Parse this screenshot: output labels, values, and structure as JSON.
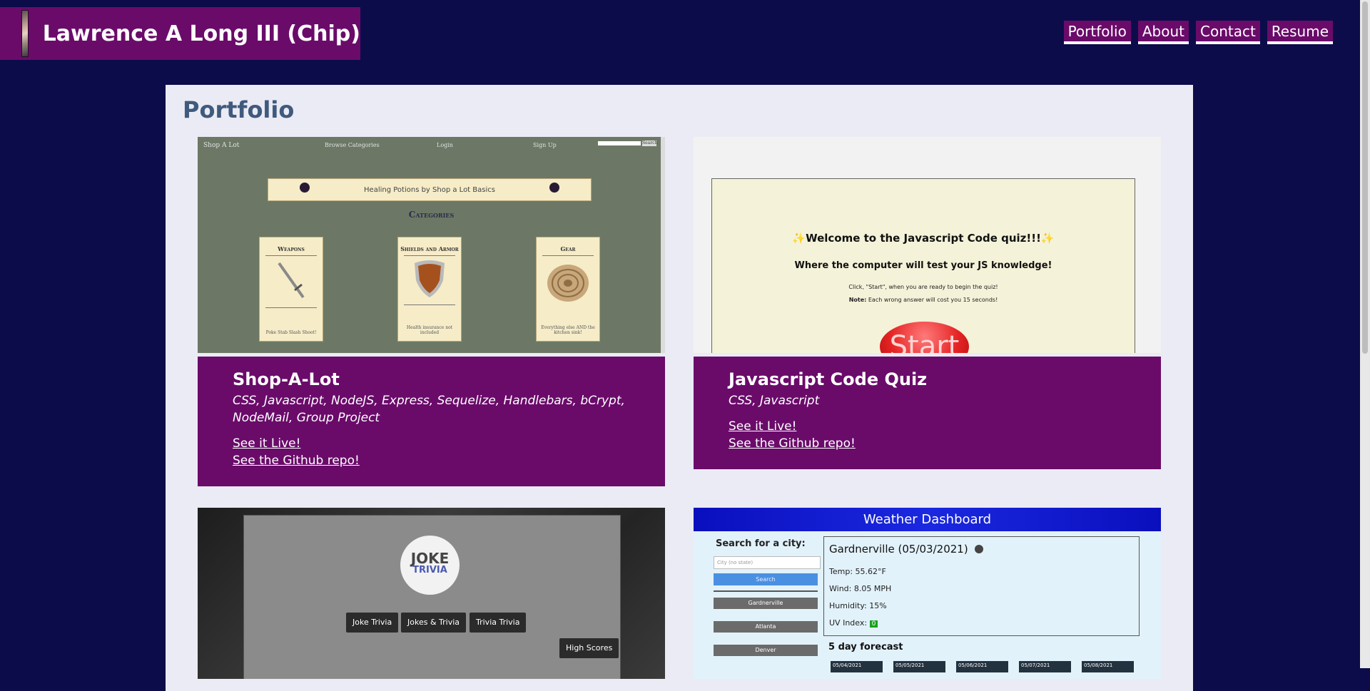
{
  "header": {
    "site_title": "Lawrence A Long III (Chip)"
  },
  "nav": [
    "Portfolio",
    "About",
    "Contact",
    "Resume"
  ],
  "main": {
    "heading": "Portfolio"
  },
  "projects": [
    {
      "title": "Shop-A-Lot",
      "tech": "CSS, Javascript, NodeJS, Express, Sequelize, Handlebars, bCrypt, NodeMail, Group Project",
      "live_link": "See it Live!",
      "repo_link": "See the Github repo!",
      "screenshot": {
        "brand": "Shop A Lot",
        "nav": [
          "Browse Categories",
          "Login",
          "Sign Up"
        ],
        "search_button": "Search",
        "banner": "Healing Potions by Shop a Lot Basics",
        "categories_heading": "Categories",
        "categories": [
          {
            "name": "Weapons",
            "desc": "Poke Stab Slash Shoot!"
          },
          {
            "name": "Shields and Armor",
            "desc": "Health insurance not included"
          },
          {
            "name": "Gear",
            "desc": "Everything else AND the kitchen sink!"
          }
        ]
      }
    },
    {
      "title": "Javascript Code Quiz",
      "tech": "CSS, Javascript",
      "live_link": "See it Live!",
      "repo_link": "See the Github repo!",
      "screenshot": {
        "welcome": "✨Welcome to the Javascript Code quiz!!!✨",
        "subtitle": "Where the computer will test your JS knowledge!",
        "instruction": "Click, \"Start\", when you are ready to begin the quiz!",
        "note_label": "Note:",
        "note_text": " Each wrong answer will cost you 15 seconds!",
        "start": "Start"
      }
    },
    {
      "title": "Joke Trivia",
      "screenshot": {
        "logo_top": "JOKE",
        "logo_bottom": "TRIVIA",
        "buttons": [
          "Joke Trivia",
          "Jokes & Trivia",
          "Trivia Trivia"
        ],
        "high_scores": "High Scores"
      }
    },
    {
      "title": "Weather Dashboard",
      "screenshot": {
        "bar_title": "Weather Dashboard",
        "search_label": "Search for a city:",
        "input_placeholder": "City (no state)",
        "search_button": "Search",
        "cities": [
          "Gardnerville",
          "Atlanta",
          "Denver"
        ],
        "current_title": "Gardnerville (05/03/2021)",
        "temp": "Temp: 55.62°F",
        "wind": "Wind: 8.05 MPH",
        "humidity": "Humidity: 15%",
        "uv_label": "UV Index:",
        "uv_value": "0",
        "forecast_heading": "5 day forecast",
        "forecast_days": [
          "05/04/2021",
          "05/05/2021",
          "05/06/2021",
          "05/07/2021",
          "05/08/2021"
        ]
      }
    }
  ],
  "colors": {
    "background": "#0c0c4a",
    "accent": "#6a0b6a",
    "heading": "#3f5a7d",
    "panel": "#ebebf5"
  }
}
